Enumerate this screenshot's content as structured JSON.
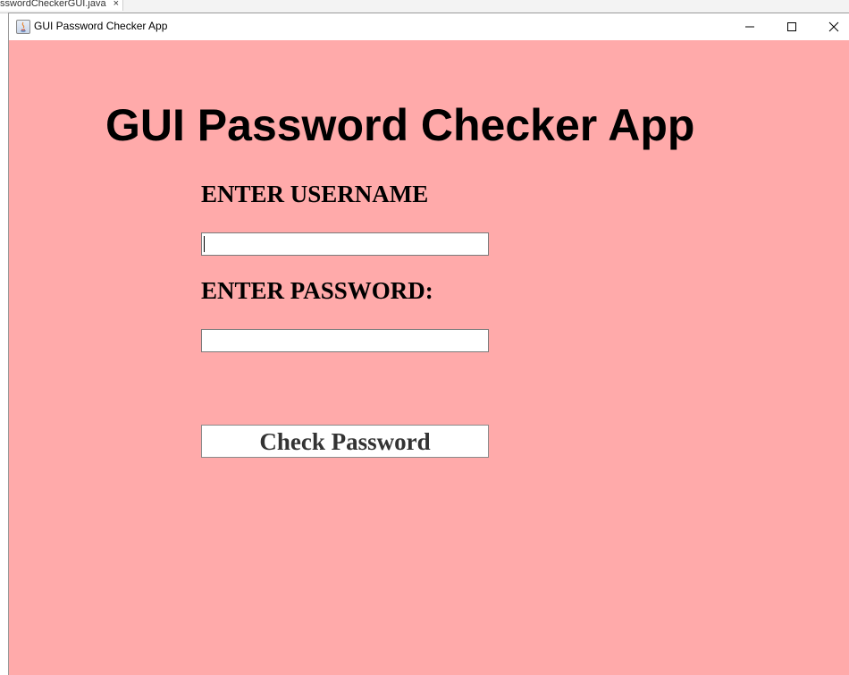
{
  "background_tab": {
    "label": "sswordCheckerGUI.java",
    "close_glyph": "×"
  },
  "window": {
    "title": "GUI Password Checker App",
    "icon": "java-app-icon",
    "controls": {
      "minimize_icon": "minimize-icon",
      "maximize_icon": "maximize-icon",
      "close_icon": "close-icon"
    }
  },
  "app": {
    "heading": "GUI Password Checker App",
    "username_label": "ENTER USERNAME",
    "username_value": "",
    "password_label": "ENTER PASSWORD:",
    "password_value": "",
    "check_button_label": "Check Password"
  },
  "colors": {
    "panel_background": "#ffaaaa",
    "titlebar_background": "#ffffff",
    "heading_text": "#000000",
    "button_text": "#333333"
  }
}
